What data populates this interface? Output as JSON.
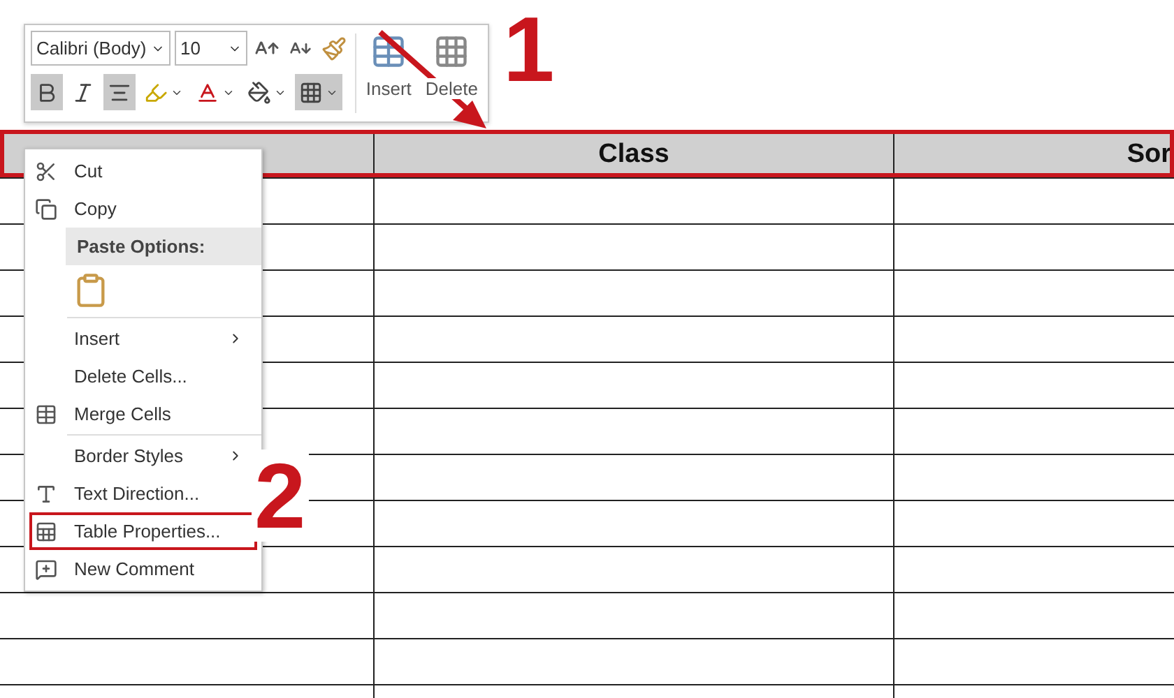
{
  "toolbar": {
    "font": "Calibri (Body)",
    "size": "10",
    "buttons": [
      {
        "kind": "bold",
        "selected": true
      },
      {
        "kind": "italic",
        "selected": false
      },
      {
        "kind": "center",
        "selected": true
      },
      {
        "kind": "highlight",
        "selected": false
      },
      {
        "kind": "font-color",
        "selected": false
      },
      {
        "kind": "shading",
        "selected": false
      },
      {
        "kind": "borders",
        "selected": true
      }
    ],
    "table_actions": [
      "Insert",
      "Delete"
    ]
  },
  "table": {
    "header_marked": true,
    "columns": [
      "",
      "Class",
      "Sor"
    ]
  },
  "context_menu": [
    {
      "kind": "item",
      "label": "Cut",
      "submenu": false,
      "marked": false
    },
    {
      "kind": "item",
      "label": "Copy",
      "submenu": false,
      "marked": false
    },
    {
      "kind": "header",
      "label": "Paste Options:"
    },
    {
      "kind": "paste"
    },
    {
      "kind": "separator"
    },
    {
      "kind": "item",
      "label": "Insert",
      "submenu": true,
      "marked": false
    },
    {
      "kind": "item",
      "label": "Delete Cells...",
      "submenu": false,
      "marked": false
    },
    {
      "kind": "item",
      "label": "Merge Cells",
      "submenu": false,
      "marked": false
    },
    {
      "kind": "separator"
    },
    {
      "kind": "item",
      "label": "Border Styles",
      "submenu": true,
      "marked": false
    },
    {
      "kind": "item",
      "label": "Text Direction...",
      "submenu": false,
      "marked": false
    },
    {
      "kind": "item",
      "label": "Table Properties...",
      "submenu": false,
      "marked": true
    },
    {
      "kind": "item",
      "label": "New Comment",
      "submenu": false,
      "marked": false
    }
  ],
  "step_numbers": [
    "1",
    "2"
  ]
}
